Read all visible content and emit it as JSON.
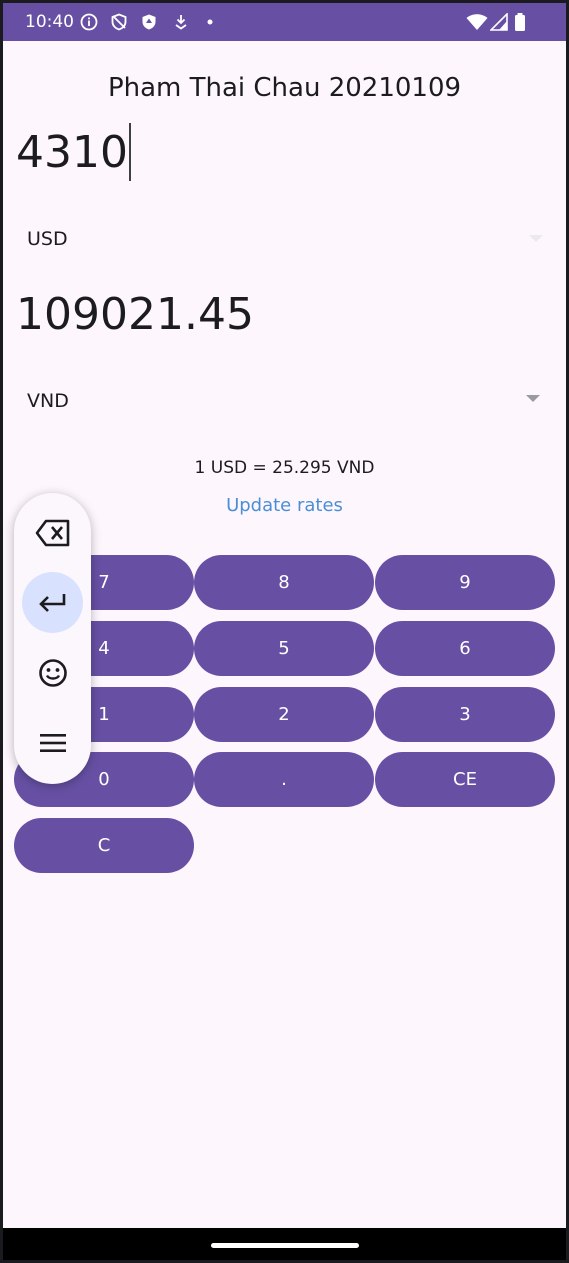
{
  "status_bar": {
    "time": "10:40",
    "left_icons": [
      "info-icon",
      "shield-icon",
      "shield-filled-icon",
      "download-icon",
      "dot-icon"
    ],
    "right_icons": [
      "wifi-icon",
      "signal-icon",
      "battery-icon"
    ]
  },
  "app": {
    "title": "Pham Thai Chau 20210109",
    "input_amount": "4310",
    "from_currency": "USD",
    "result_amount": "109021.45",
    "to_currency": "VND",
    "rate_text": "1 USD = 25.295 VND",
    "update_label": "Update rates"
  },
  "keypad": {
    "k7": "7",
    "k8": "8",
    "k9": "9",
    "k4": "4",
    "k5": "5",
    "k6": "6",
    "k1": "1",
    "k2": "2",
    "k3": "3",
    "k0": "0",
    "kdot": ".",
    "kce": "CE",
    "kc": "C"
  },
  "floating_toolbar": {
    "items": [
      "backspace-icon",
      "enter-icon",
      "emoji-icon",
      "menu-icon"
    ],
    "active": "enter-icon"
  },
  "colors": {
    "accent": "#6750a4",
    "background": "#fdf6fd",
    "link": "#4a8fd6",
    "active_bubble": "#d8e2ff"
  }
}
